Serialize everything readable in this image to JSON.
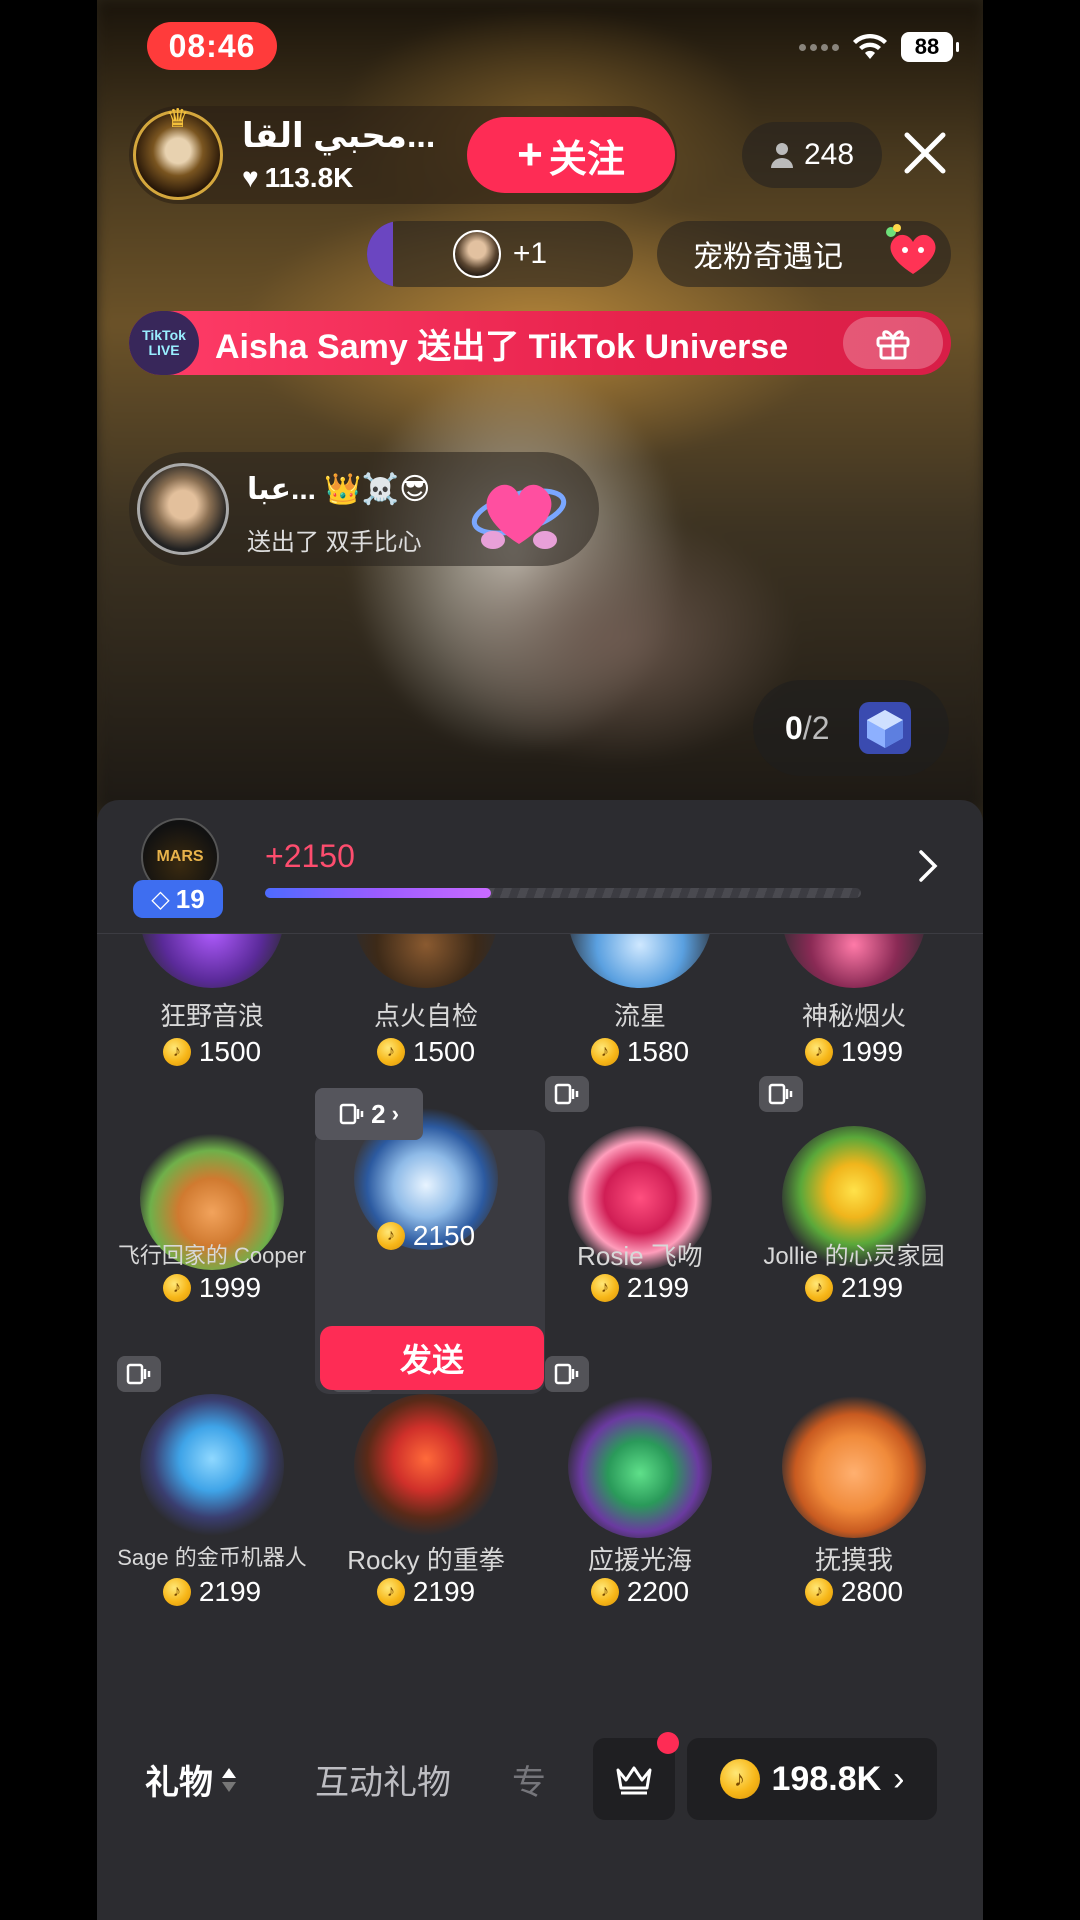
{
  "status_bar": {
    "time": "08:46",
    "battery": "88"
  },
  "host": {
    "name": "محبي القا...",
    "likes": "113.8K",
    "follow_label": "关注"
  },
  "viewers": {
    "count": "248"
  },
  "rank": {
    "extra": "+1"
  },
  "event": {
    "label": "宠粉奇遇记"
  },
  "banner": {
    "logo_text": "TikTok LIVE",
    "text": "Aisha Samy 送出了 TikTok Universe"
  },
  "gift_notice": {
    "sender": "عبا... 👑☠️😎",
    "action": "送出了 双手比心"
  },
  "goal": {
    "progress": "0",
    "total": "/2"
  },
  "level": {
    "avatar_text": "MARS",
    "badge": "19",
    "xp_gain": "+2150",
    "xp_fraction": 0.38
  },
  "gifts_row0": [
    {
      "name": "狂野音浪",
      "price": "1500"
    },
    {
      "name": "点火自检",
      "price": "1500"
    },
    {
      "name": "流星",
      "price": "1580"
    },
    {
      "name": "神秘烟火",
      "price": "1999"
    }
  ],
  "gifts_row1": [
    {
      "name": "飞行回家的 Cooper",
      "price": "1999"
    },
    {
      "name": "",
      "price": "2150"
    },
    {
      "name": "Rosie 飞吻",
      "price": "2199"
    },
    {
      "name": "Jollie 的心灵家园",
      "price": "2199"
    }
  ],
  "selected": {
    "variant_count": "2",
    "send_label": "发送"
  },
  "gifts_row2": [
    {
      "name": "Sage 的金币机器人",
      "price": "2199"
    },
    {
      "name": "Rocky 的重拳",
      "price": "2199"
    },
    {
      "name": "应援光海",
      "price": "2200"
    },
    {
      "name": "抚摸我",
      "price": "2800"
    }
  ],
  "tabs": {
    "gift": "礼物",
    "interactive": "互动礼物",
    "exclusive": "专"
  },
  "balance": {
    "amount": "198.8K"
  },
  "colors": {
    "accent": "#fe2c55",
    "coin": "#f7b719",
    "panel": "#2c2c30"
  }
}
